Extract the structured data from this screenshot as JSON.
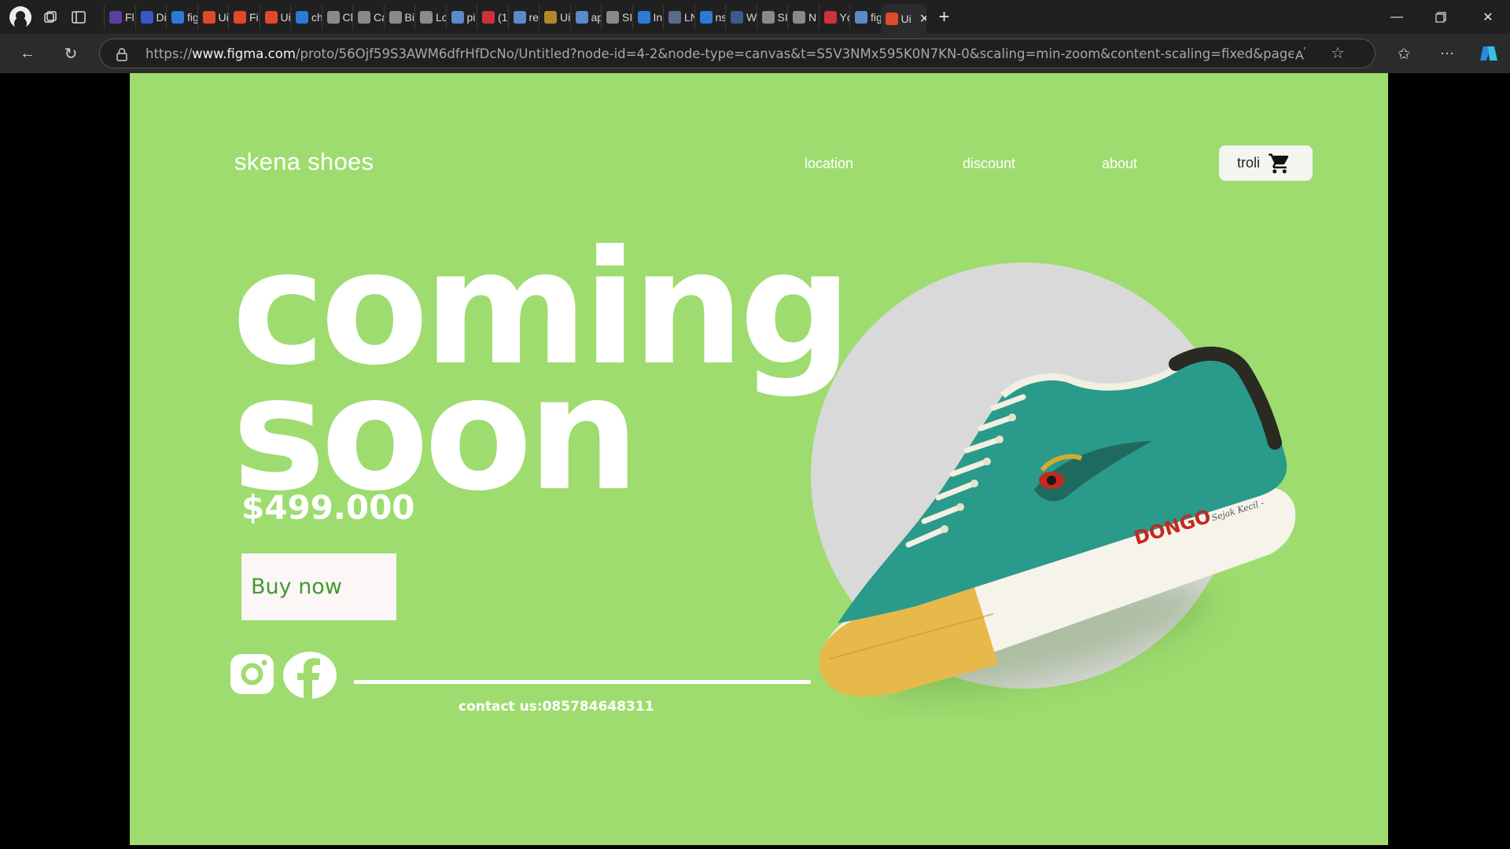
{
  "browser": {
    "url_host": "www.figma.com",
    "url_prefix": "https://",
    "url_rest": "/proto/56Ojf59S3AWM6dfrHfDcNo/Untitled?node-id=4-2&node-type=canvas&t=S5V3NMx595K0N7KN-0&scaling=min-zoom&content-scaling=fixed&page-id=...",
    "tabs": [
      {
        "label": "Fl",
        "color": "#5b3fa0"
      },
      {
        "label": "Di",
        "color": "#3a56c4"
      },
      {
        "label": "fig",
        "color": "#2a7ad6"
      },
      {
        "label": "Ui",
        "color": "#e04a2a"
      },
      {
        "label": "Fi",
        "color": "#e04a2a"
      },
      {
        "label": "Ui",
        "color": "#e04a2a"
      },
      {
        "label": "ch",
        "color": "#2a7ad6"
      },
      {
        "label": "Cl",
        "color": "#8a8a8a"
      },
      {
        "label": "Ca",
        "color": "#8a8a8a"
      },
      {
        "label": "Bi",
        "color": "#8a8a8a"
      },
      {
        "label": "Lc",
        "color": "#8a8a8a"
      },
      {
        "label": "pi",
        "color": "#5a8ac8"
      },
      {
        "label": "(1",
        "color": "#d0303a"
      },
      {
        "label": "re",
        "color": "#5a8ac8"
      },
      {
        "label": "Ui",
        "color": "#b08a2a"
      },
      {
        "label": "ap",
        "color": "#5a8ac8"
      },
      {
        "label": "SI",
        "color": "#8a8a8a"
      },
      {
        "label": "In",
        "color": "#2a7ad6"
      },
      {
        "label": "LN",
        "color": "#5a6a8a"
      },
      {
        "label": "ns",
        "color": "#2a7ad6"
      },
      {
        "label": "W",
        "color": "#3a5a8a"
      },
      {
        "label": "SI",
        "color": "#8a8a8a"
      },
      {
        "label": "N",
        "color": "#8a8a8a"
      },
      {
        "label": "Yc",
        "color": "#d0303a"
      },
      {
        "label": "fig",
        "color": "#5a8ac8"
      },
      {
        "label": "Ui",
        "color": "#e04a2a"
      }
    ],
    "active_tab": "Ui"
  },
  "site": {
    "brand": "skena shoes",
    "nav": [
      "location",
      "discount",
      "about"
    ],
    "cart_label": "troli",
    "headline_line1": "coming",
    "headline_line2": "soon",
    "price": "$499.000",
    "buy_label": "Buy now",
    "contact": "contact us:085784648311",
    "shoe_brand": "DONGO",
    "shoe_tagline": "- Sejak Kecil -"
  },
  "colors": {
    "background": "#9edc6f",
    "circle": "#d9d9d9",
    "button_text": "#3f9b2e",
    "shoe_upper": "#2a9a8a",
    "shoe_sole_accent": "#e6b94a"
  }
}
